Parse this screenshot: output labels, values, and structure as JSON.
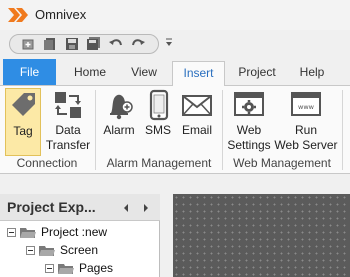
{
  "app": {
    "title": "Omnivex"
  },
  "quick_access": {
    "icons": [
      "new-icon",
      "open-icon",
      "save-icon",
      "save-all-icon",
      "undo-icon",
      "redo-icon",
      "customize-icon"
    ]
  },
  "tabs": [
    {
      "label": "File"
    },
    {
      "label": "Home"
    },
    {
      "label": "View"
    },
    {
      "label": "Insert"
    },
    {
      "label": "Project"
    },
    {
      "label": "Help"
    }
  ],
  "active_tab": "Insert",
  "ribbon": {
    "groups": [
      {
        "label": "Connection",
        "buttons": [
          {
            "line1": "Tag",
            "line2": "",
            "icon": "tag-icon"
          },
          {
            "line1": "Data",
            "line2": "Transfer",
            "icon": "data-transfer-icon"
          }
        ]
      },
      {
        "label": "Alarm Management",
        "buttons": [
          {
            "line1": "Alarm",
            "line2": "",
            "icon": "alarm-bell-icon"
          },
          {
            "line1": "SMS",
            "line2": "",
            "icon": "phone-icon"
          },
          {
            "line1": "Email",
            "line2": "",
            "icon": "envelope-icon"
          }
        ]
      },
      {
        "label": "Web Management",
        "buttons": [
          {
            "line1": "Web",
            "line2": "Settings",
            "icon": "web-settings-icon"
          },
          {
            "line1": "Run",
            "line2": "Web Server",
            "icon": "web-server-icon"
          }
        ]
      }
    ]
  },
  "explorer": {
    "title": "Project Exp...",
    "tree": [
      {
        "label": "Project :new"
      },
      {
        "label": "Screen"
      },
      {
        "label": "Pages"
      }
    ]
  },
  "colors": {
    "accent": "#2f8de4",
    "selected_bg": "#fce9a6",
    "canvas_bg": "#5b5b5b"
  }
}
